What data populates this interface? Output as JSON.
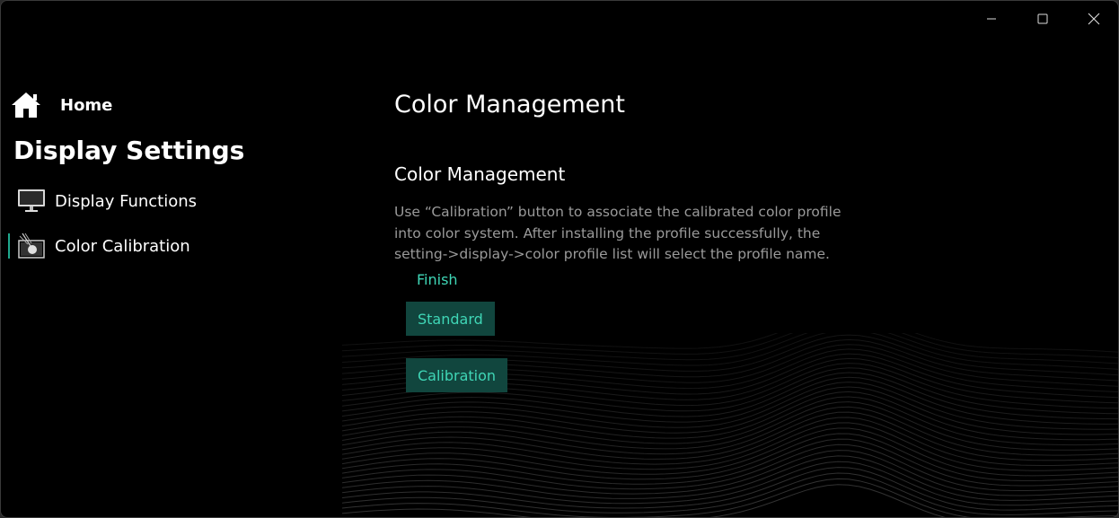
{
  "window": {
    "controls": {
      "minimize_icon": "minimize-icon",
      "maximize_icon": "maximize-icon",
      "close_icon": "close-icon"
    }
  },
  "sidebar": {
    "home": {
      "label": "Home",
      "icon": "home-icon"
    },
    "section_title": "Display Settings",
    "items": [
      {
        "label": "Display Functions",
        "icon": "monitor-icon",
        "active": false
      },
      {
        "label": "Color Calibration",
        "icon": "color-calibration-icon",
        "active": true
      }
    ]
  },
  "main": {
    "page_title": "Color Management",
    "section_title": "Color Management",
    "description": "Use “Calibration” button to associate the calibrated color profile into color system. After installing the profile successfully, the setting->display->color profile list will select the profile name.",
    "status": "Finish",
    "buttons": {
      "standard": "Standard",
      "calibration": "Calibration"
    }
  },
  "colors": {
    "accent": "#3fd6b6",
    "button_bg": "#11463e",
    "background": "#000000"
  }
}
